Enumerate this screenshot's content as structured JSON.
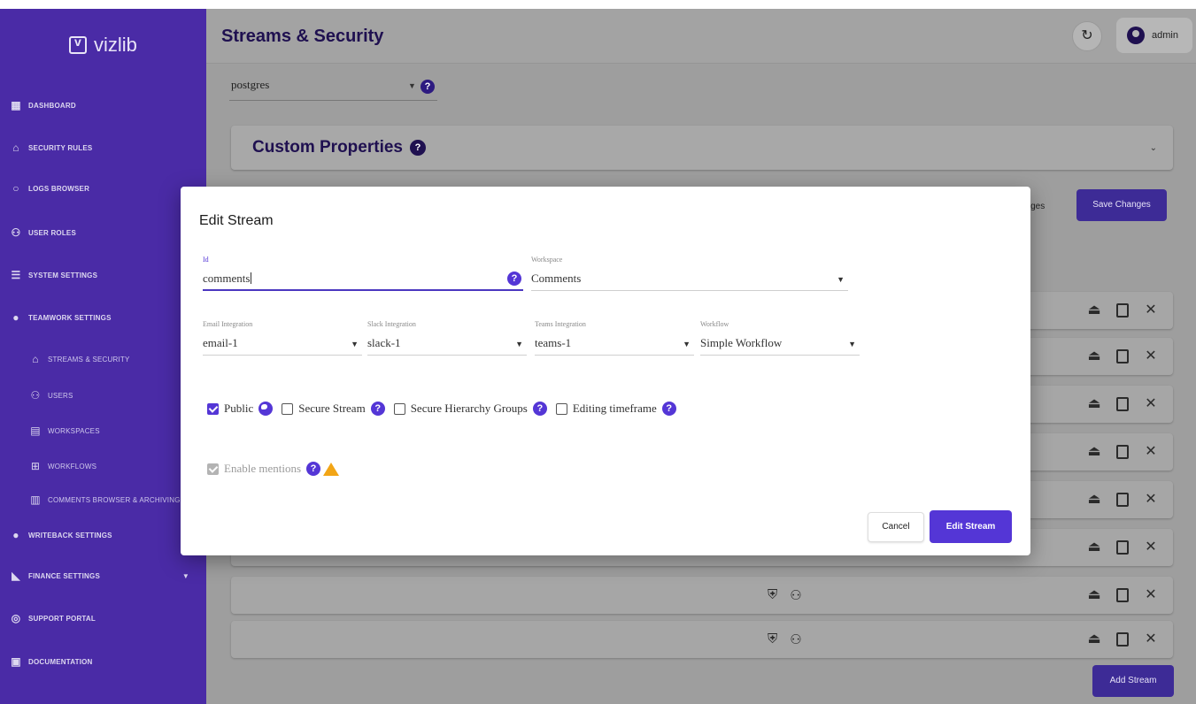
{
  "brand": {
    "name": "vizlib"
  },
  "sidebar": {
    "items": [
      {
        "label": "DASHBOARD",
        "icon": "dashboard-icon"
      },
      {
        "label": "SECURITY RULES",
        "icon": "lock-icon"
      },
      {
        "label": "LOGS BROWSER",
        "icon": "search-icon"
      },
      {
        "label": "USER ROLES",
        "icon": "users-icon"
      },
      {
        "label": "SYSTEM SETTINGS",
        "icon": "sliders-icon"
      },
      {
        "label": "TEAMWORK SETTINGS",
        "icon": "teamwork-icon"
      },
      {
        "label": "STREAMS & SECURITY",
        "icon": "lock-icon"
      },
      {
        "label": "USERS",
        "icon": "users-icon"
      },
      {
        "label": "WORKSPACES",
        "icon": "workspace-icon"
      },
      {
        "label": "WORKFLOWS",
        "icon": "workflow-icon"
      },
      {
        "label": "COMMENTS BROWSER & ARCHIVING",
        "icon": "archive-icon"
      },
      {
        "label": "WRITEBACK SETTINGS",
        "icon": "writeback-icon"
      },
      {
        "label": "FINANCE SETTINGS",
        "icon": "finance-icon"
      },
      {
        "label": "SUPPORT PORTAL",
        "icon": "support-icon"
      },
      {
        "label": "DOCUMENTATION",
        "icon": "document-icon"
      }
    ]
  },
  "header": {
    "title": "Streams & Security",
    "user": "admin"
  },
  "background": {
    "db_value": "postgres",
    "custom_properties": "Custom Properties",
    "partial_changes_label": "anges",
    "save_label": "Save Changes",
    "add_stream_label": "Add Stream"
  },
  "modal": {
    "title": "Edit Stream",
    "id_label": "Id",
    "id_value": "comments",
    "workspace_label": "Workspace",
    "workspace_value": "Comments",
    "email_label": "Email Integration",
    "email_value": "email-1",
    "slack_label": "Slack Integration",
    "slack_value": "slack-1",
    "teams_label": "Teams Integration",
    "teams_value": "teams-1",
    "workflow_label": "Workflow",
    "workflow_value": "Simple Workflow",
    "checkboxes": {
      "public": "Public",
      "secure_stream": "Secure Stream",
      "secure_hierarchy": "Secure Hierarchy Groups",
      "editing_timeframe": "Editing timeframe",
      "enable_mentions": "Enable mentions"
    },
    "cancel_label": "Cancel",
    "submit_label": "Edit Stream"
  },
  "colors": {
    "sidebar_bg": "#4a2ba6",
    "accent": "#5436d6",
    "primary_dark": "#1f1050",
    "warning": "#f2a516"
  }
}
